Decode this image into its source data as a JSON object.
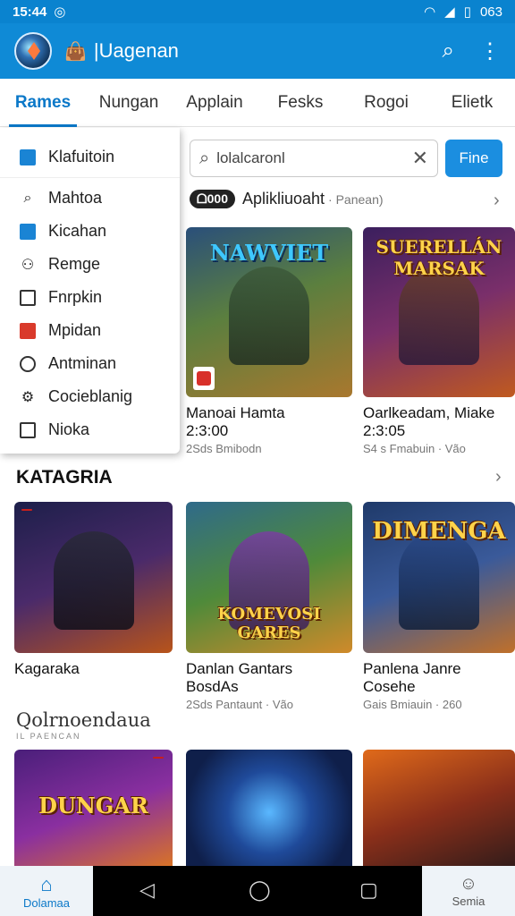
{
  "status": {
    "time": "15:44",
    "battery": "063"
  },
  "appbar": {
    "title": "|Uagenan"
  },
  "tabs": [
    {
      "label": "Rames",
      "active": true
    },
    {
      "label": "Nungan"
    },
    {
      "label": "Applain"
    },
    {
      "label": "Fesks"
    },
    {
      "label": "Rogoi"
    },
    {
      "label": "Elietk"
    }
  ],
  "dropdown": [
    {
      "label": "Klafuitoin",
      "icon": "app-icon"
    },
    {
      "label": "Mahtoa",
      "icon": "search-icon"
    },
    {
      "label": "Kicahan",
      "icon": "refresh-icon"
    },
    {
      "label": "Remge",
      "icon": "user-icon"
    },
    {
      "label": "Fnrpkin",
      "icon": "checkbox-icon"
    },
    {
      "label": "Mpidan",
      "icon": "record-icon"
    },
    {
      "label": "Antminan",
      "icon": "circle-icon"
    },
    {
      "label": "Cocieblanig",
      "icon": "gear-icon"
    },
    {
      "label": "Nioka",
      "icon": "checkbox-icon"
    }
  ],
  "search": {
    "value": "lolalcaronl",
    "button": "Fine"
  },
  "section1": {
    "pill": "ᗝ000",
    "label": "Aplikliuoaht",
    "sub": "· Panean)"
  },
  "row1": [
    {
      "art": "NAWVIET",
      "name": "Manoai Hamta\n2:3:00",
      "meta": "2Sds Bmibodn"
    },
    {
      "art": "SUERELLÁN MARSAK",
      "name": "Oarlkeadam, Miake\n2:3:05",
      "meta": "S4 s Fmabuin · Vão"
    }
  ],
  "heading2": "KATAGRIA",
  "row2": [
    {
      "art": "",
      "name": "Kagaraka",
      "meta": ""
    },
    {
      "art": "KOMEVOSI GARES",
      "name": "Danlan Gantars\nBosdAs",
      "meta": "2Sds Pantaunt · Vão"
    },
    {
      "art": "DIMENGA",
      "name": "Panlena Janre\nCosehe",
      "meta": "Gais Bmiauin · 260"
    }
  ],
  "heading3": {
    "title": "Qolrnoendaua",
    "sub": "IL PAENCAN"
  },
  "row3": [
    {
      "art": "DUNGAR"
    },
    {
      "art": ""
    },
    {
      "art": ""
    }
  ],
  "bottom": {
    "left": "Dolamaa",
    "right": "Semia"
  },
  "colors": {
    "accent": "#0f8ad6",
    "statusbar": "#0a83cf"
  }
}
